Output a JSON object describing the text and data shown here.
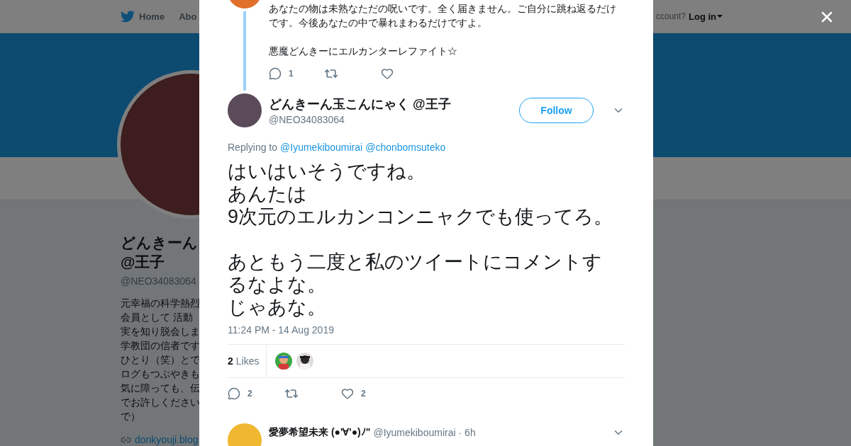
{
  "nav": {
    "items": [
      {
        "label": "Home"
      },
      {
        "label": "Abo"
      }
    ],
    "account_prompt": "ccount?",
    "login": "Log in"
  },
  "profile": {
    "name_lines": [
      "どんきーん",
      "@王子"
    ],
    "handle": "@NEO34083064",
    "bio_lines": [
      "元幸福の科学熱烈",
      "会員として 活動",
      "実を知り脱会しま",
      "学教団の信者です",
      "ひとり（笑）とで",
      "ログもつぶやきも",
      "気に障っても、伝",
      "でお許しください",
      "で）"
    ],
    "link": "donkyouji.blog"
  },
  "parent_tweet": {
    "paragraphs": [
      "あなたの物は未熟なただの呪いです。全く届きません。ご自分に跳ね返るだけです。今後あなたの中で暴れまわるだけですよ。",
      "悪魔どんきーにエルカンターレファイト☆"
    ],
    "replies": "1"
  },
  "tweet": {
    "name": "どんきーん玉こんにゃく @王子",
    "handle": "@NEO34083064",
    "follow": "Follow",
    "replying_label": "Replying to",
    "reply_to": [
      "@Iyumekiboumirai",
      "@chonbomsuteko"
    ],
    "paragraphs": [
      [
        "はいはいそうですね。",
        "あんたは",
        "9次元のエルカンコンニャクでも使ってろ。"
      ],
      [
        "あともう二度と私のツイートにコメントするなよな。",
        "じゃあな。"
      ]
    ],
    "time": "11:24 PM - 14 Aug 2019",
    "likes_count": "2",
    "likes_label": "Likes",
    "likers": [
      {
        "kind": "picture"
      },
      {
        "kind": "picture"
      }
    ],
    "replies": "2",
    "likes": "2"
  },
  "next_tweet": {
    "name": "愛夢希望未来 (●'∀'●)ﾉ\"",
    "handle": "@Iyumekiboumirai",
    "time": "· 6h"
  }
}
